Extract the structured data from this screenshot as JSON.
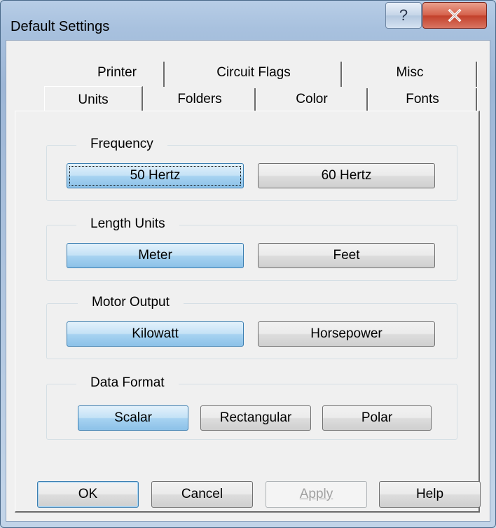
{
  "window": {
    "title": "Default Settings",
    "help_glyph": "?"
  },
  "tabs": {
    "back_row": [
      "Printer",
      "Circuit Flags",
      "Misc"
    ],
    "front_row": [
      "Units",
      "Folders",
      "Color",
      "Fonts"
    ],
    "active": "Units"
  },
  "groups": {
    "frequency": {
      "label": "Frequency",
      "options": [
        "50 Hertz",
        "60 Hertz"
      ],
      "selected": "50 Hertz"
    },
    "length_units": {
      "label": "Length Units",
      "options": [
        "Meter",
        "Feet"
      ],
      "selected": "Meter"
    },
    "motor_output": {
      "label": "Motor Output",
      "options": [
        "Kilowatt",
        "Horsepower"
      ],
      "selected": "Kilowatt"
    },
    "data_format": {
      "label": "Data Format",
      "options": [
        "Scalar",
        "Rectangular",
        "Polar"
      ],
      "selected": "Scalar"
    }
  },
  "buttons": {
    "ok": "OK",
    "cancel": "Cancel",
    "apply": "Apply",
    "help": "Help"
  },
  "icons": {
    "help": "question-mark-icon",
    "close": "close-x-icon"
  },
  "colors": {
    "selected_button": "#a7d3f1",
    "close_button": "#c2402a",
    "title_bar": "#a8c1de"
  }
}
